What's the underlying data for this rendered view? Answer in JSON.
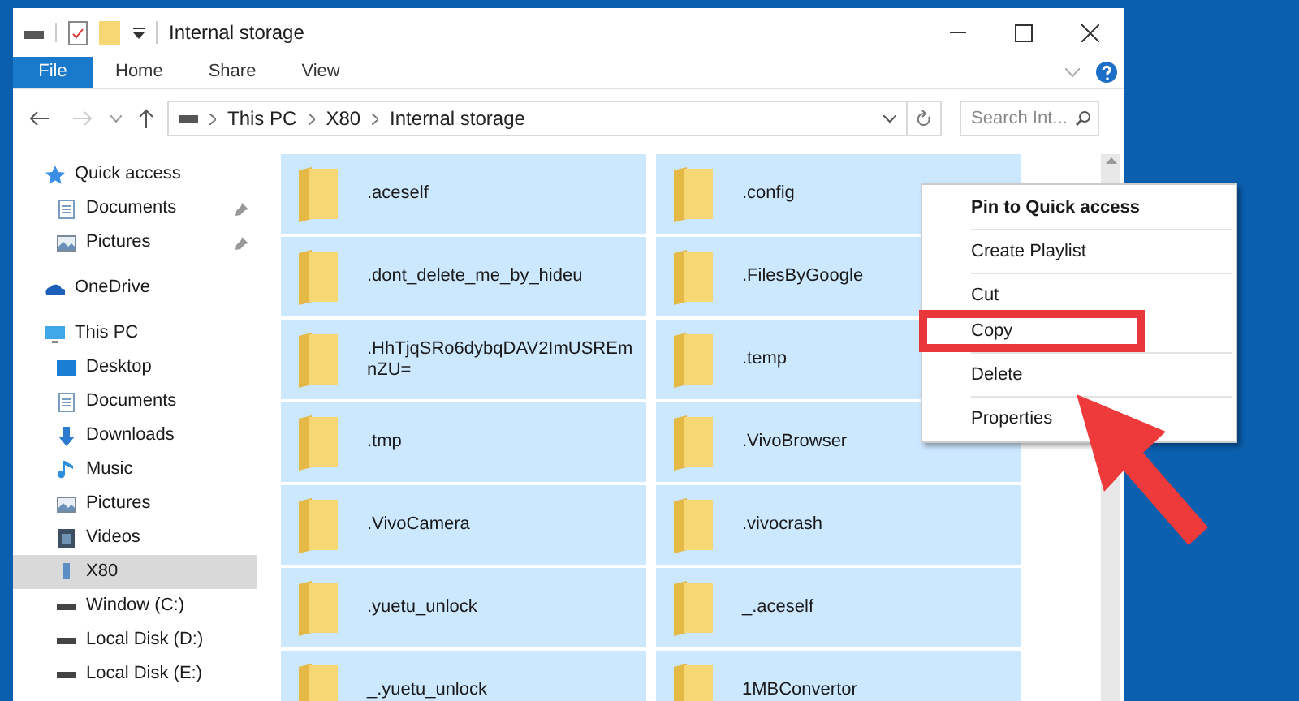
{
  "window": {
    "title": "Internal storage"
  },
  "ribbon_tabs": [
    {
      "label": "File",
      "kind": "file",
      "selected": false
    },
    {
      "label": "Home",
      "kind": "tab",
      "selected": false
    },
    {
      "label": "Share",
      "kind": "tab",
      "selected": false
    },
    {
      "label": "View",
      "kind": "tab",
      "selected": false
    }
  ],
  "address_bar": {
    "path": [
      "This PC",
      "X80",
      "Internal storage"
    ]
  },
  "search": {
    "placeholder": "Search Int..."
  },
  "sidebar": {
    "items": [
      {
        "label": "Quick access",
        "selected": false,
        "children": [
          {
            "label": "Documents",
            "pinned": true,
            "selected": false
          },
          {
            "label": "Pictures",
            "pinned": true,
            "selected": false
          }
        ]
      },
      {
        "label": "OneDrive",
        "selected": false
      },
      {
        "label": "This PC",
        "selected": false,
        "children": [
          {
            "label": "Desktop",
            "selected": false
          },
          {
            "label": "Documents",
            "selected": false
          },
          {
            "label": "Downloads",
            "selected": false
          },
          {
            "label": "Music",
            "selected": false
          },
          {
            "label": "Pictures",
            "selected": false
          },
          {
            "label": "Videos",
            "selected": false
          },
          {
            "label": "X80",
            "selected": true
          },
          {
            "label": "Window (C:)",
            "selected": false
          },
          {
            "label": "Local Disk (D:)",
            "selected": false
          },
          {
            "label": "Local Disk (E:)",
            "selected": false
          }
        ]
      }
    ]
  },
  "files": [
    {
      "name": ".aceself",
      "selected": true
    },
    {
      "name": ".config",
      "selected": true
    },
    {
      "name": ".dont_delete_me_by_hideu",
      "selected": true
    },
    {
      "name": ".FilesByGoogle",
      "selected": true
    },
    {
      "name": ".HhTjqSRo6dybqDAV2ImUSREmnZU=",
      "selected": true
    },
    {
      "name": ".temp",
      "selected": true
    },
    {
      "name": ".tmp",
      "selected": true
    },
    {
      "name": ".VivoBrowser",
      "selected": true
    },
    {
      "name": ".VivoCamera",
      "selected": true
    },
    {
      "name": ".vivocrash",
      "selected": true
    },
    {
      "name": ".yuetu_unlock",
      "selected": true
    },
    {
      "name": "_.aceself",
      "selected": true
    },
    {
      "name": "_.yuetu_unlock",
      "selected": true
    },
    {
      "name": "1MBConvertor",
      "selected": true
    }
  ],
  "context_menu": {
    "groups": [
      [
        {
          "label": "Pin to Quick access",
          "default": true,
          "highlighted": false
        }
      ],
      [
        {
          "label": "Create Playlist",
          "default": false,
          "highlighted": false
        }
      ],
      [
        {
          "label": "Cut",
          "default": false,
          "highlighted": false
        },
        {
          "label": "Copy",
          "default": false,
          "highlighted": true
        }
      ],
      [
        {
          "label": "Delete",
          "default": false,
          "highlighted": false
        }
      ],
      [
        {
          "label": "Properties",
          "default": false,
          "highlighted": false
        }
      ]
    ]
  }
}
